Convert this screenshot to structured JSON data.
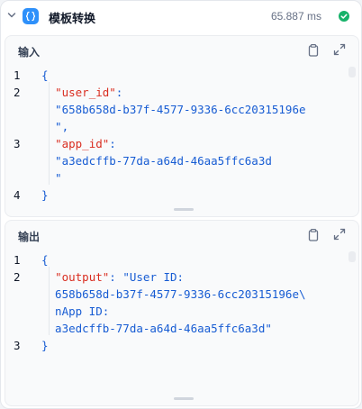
{
  "node": {
    "title": "模板转换",
    "elapsed": "65.887 ms",
    "status": "success",
    "accent": "#2e90fa",
    "status_color": "#17b26a"
  },
  "input_panel": {
    "title": "输入",
    "icons": [
      "clipboard-icon",
      "expand-icon"
    ],
    "lines": [
      {
        "num": "1",
        "parts": [
          {
            "t": "{",
            "c": "punc"
          }
        ]
      },
      {
        "num": "2",
        "parts": [
          {
            "t": "  ",
            "c": "punc"
          },
          {
            "t": "\"user_id\"",
            "c": "key"
          },
          {
            "t": ":",
            "c": "punc"
          }
        ]
      },
      {
        "num": "",
        "parts": [
          {
            "t": "  \"658b658d-b37f-4577-9336-6cc20315196e",
            "c": "str"
          }
        ]
      },
      {
        "num": "",
        "parts": [
          {
            "t": "  \"",
            "c": "str"
          },
          {
            "t": ",",
            "c": "punc"
          }
        ]
      },
      {
        "num": "3",
        "parts": [
          {
            "t": "  ",
            "c": "punc"
          },
          {
            "t": "\"app_id\"",
            "c": "key"
          },
          {
            "t": ":",
            "c": "punc"
          }
        ]
      },
      {
        "num": "",
        "parts": [
          {
            "t": "  \"a3edcffb-77da-a64d-46aa5ffc6a3d",
            "c": "str"
          }
        ]
      },
      {
        "num": "",
        "parts": [
          {
            "t": "  \"",
            "c": "str"
          }
        ]
      },
      {
        "num": "4",
        "parts": [
          {
            "t": "}",
            "c": "punc"
          }
        ]
      }
    ]
  },
  "output_panel": {
    "title": "输出",
    "icons": [
      "clipboard-icon",
      "expand-icon"
    ],
    "lines": [
      {
        "num": "1",
        "parts": [
          {
            "t": "{",
            "c": "punc"
          }
        ]
      },
      {
        "num": "2",
        "parts": [
          {
            "t": "  ",
            "c": "punc"
          },
          {
            "t": "\"output\"",
            "c": "key"
          },
          {
            "t": ": ",
            "c": "punc"
          },
          {
            "t": "\"User ID:",
            "c": "str"
          }
        ]
      },
      {
        "num": "",
        "parts": [
          {
            "t": "  658b658d-b37f-4577-9336-6cc20315196e\\",
            "c": "str"
          }
        ]
      },
      {
        "num": "",
        "parts": [
          {
            "t": "  nApp ID:",
            "c": "str"
          }
        ]
      },
      {
        "num": "",
        "parts": [
          {
            "t": "  a3edcffb-77da-a64d-46aa5ffc6a3d\"",
            "c": "str"
          }
        ]
      },
      {
        "num": "3",
        "parts": [
          {
            "t": "}",
            "c": "punc"
          }
        ]
      }
    ]
  }
}
